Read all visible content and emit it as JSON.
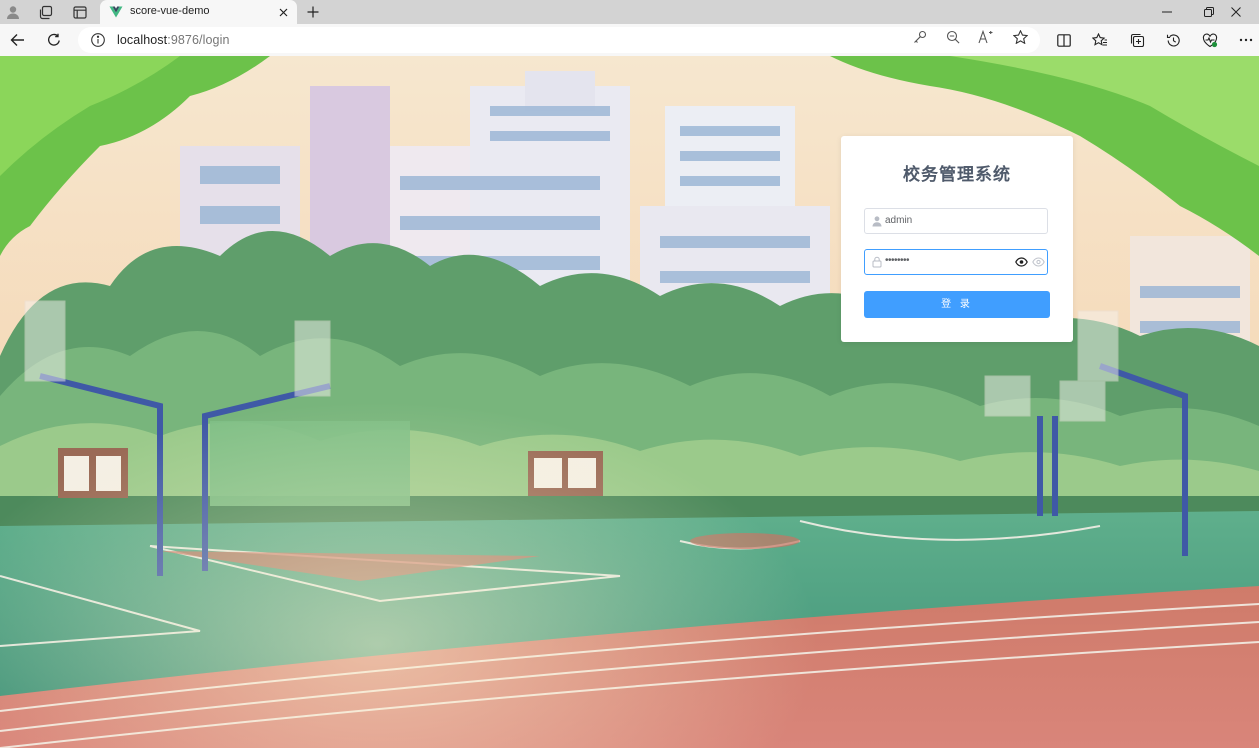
{
  "browser": {
    "tab": {
      "title": "score-vue-demo"
    },
    "address_bar": {
      "host": "localhost",
      "rest": ":9876/login"
    }
  },
  "login": {
    "title": "校务管理系统",
    "username_value": "admin",
    "password_value": "••••••••",
    "submit_label": "登 录"
  },
  "colors": {
    "primary": "#409eff",
    "title_text": "#4f5a6b",
    "card_bg": "#ffffff",
    "favicon_green": "#41b883",
    "favicon_dark": "#35495e"
  },
  "icons": {
    "browser": [
      "profile-icon",
      "workspaces-icon",
      "tab-actions-icon",
      "vue-favicon-icon",
      "close-icon",
      "plus-icon",
      "minimize-icon",
      "restore-icon",
      "window-close-icon",
      "back-arrow-icon",
      "refresh-icon",
      "info-icon",
      "key-icon",
      "zoom-out-icon",
      "read-aloud-icon",
      "star-icon",
      "split-screen-icon",
      "favorites-icon",
      "collections-icon",
      "history-icon",
      "performance-icon",
      "more-icon"
    ],
    "login": [
      "user-icon",
      "lock-icon",
      "eye-icon",
      "eye-outline-icon"
    ]
  }
}
